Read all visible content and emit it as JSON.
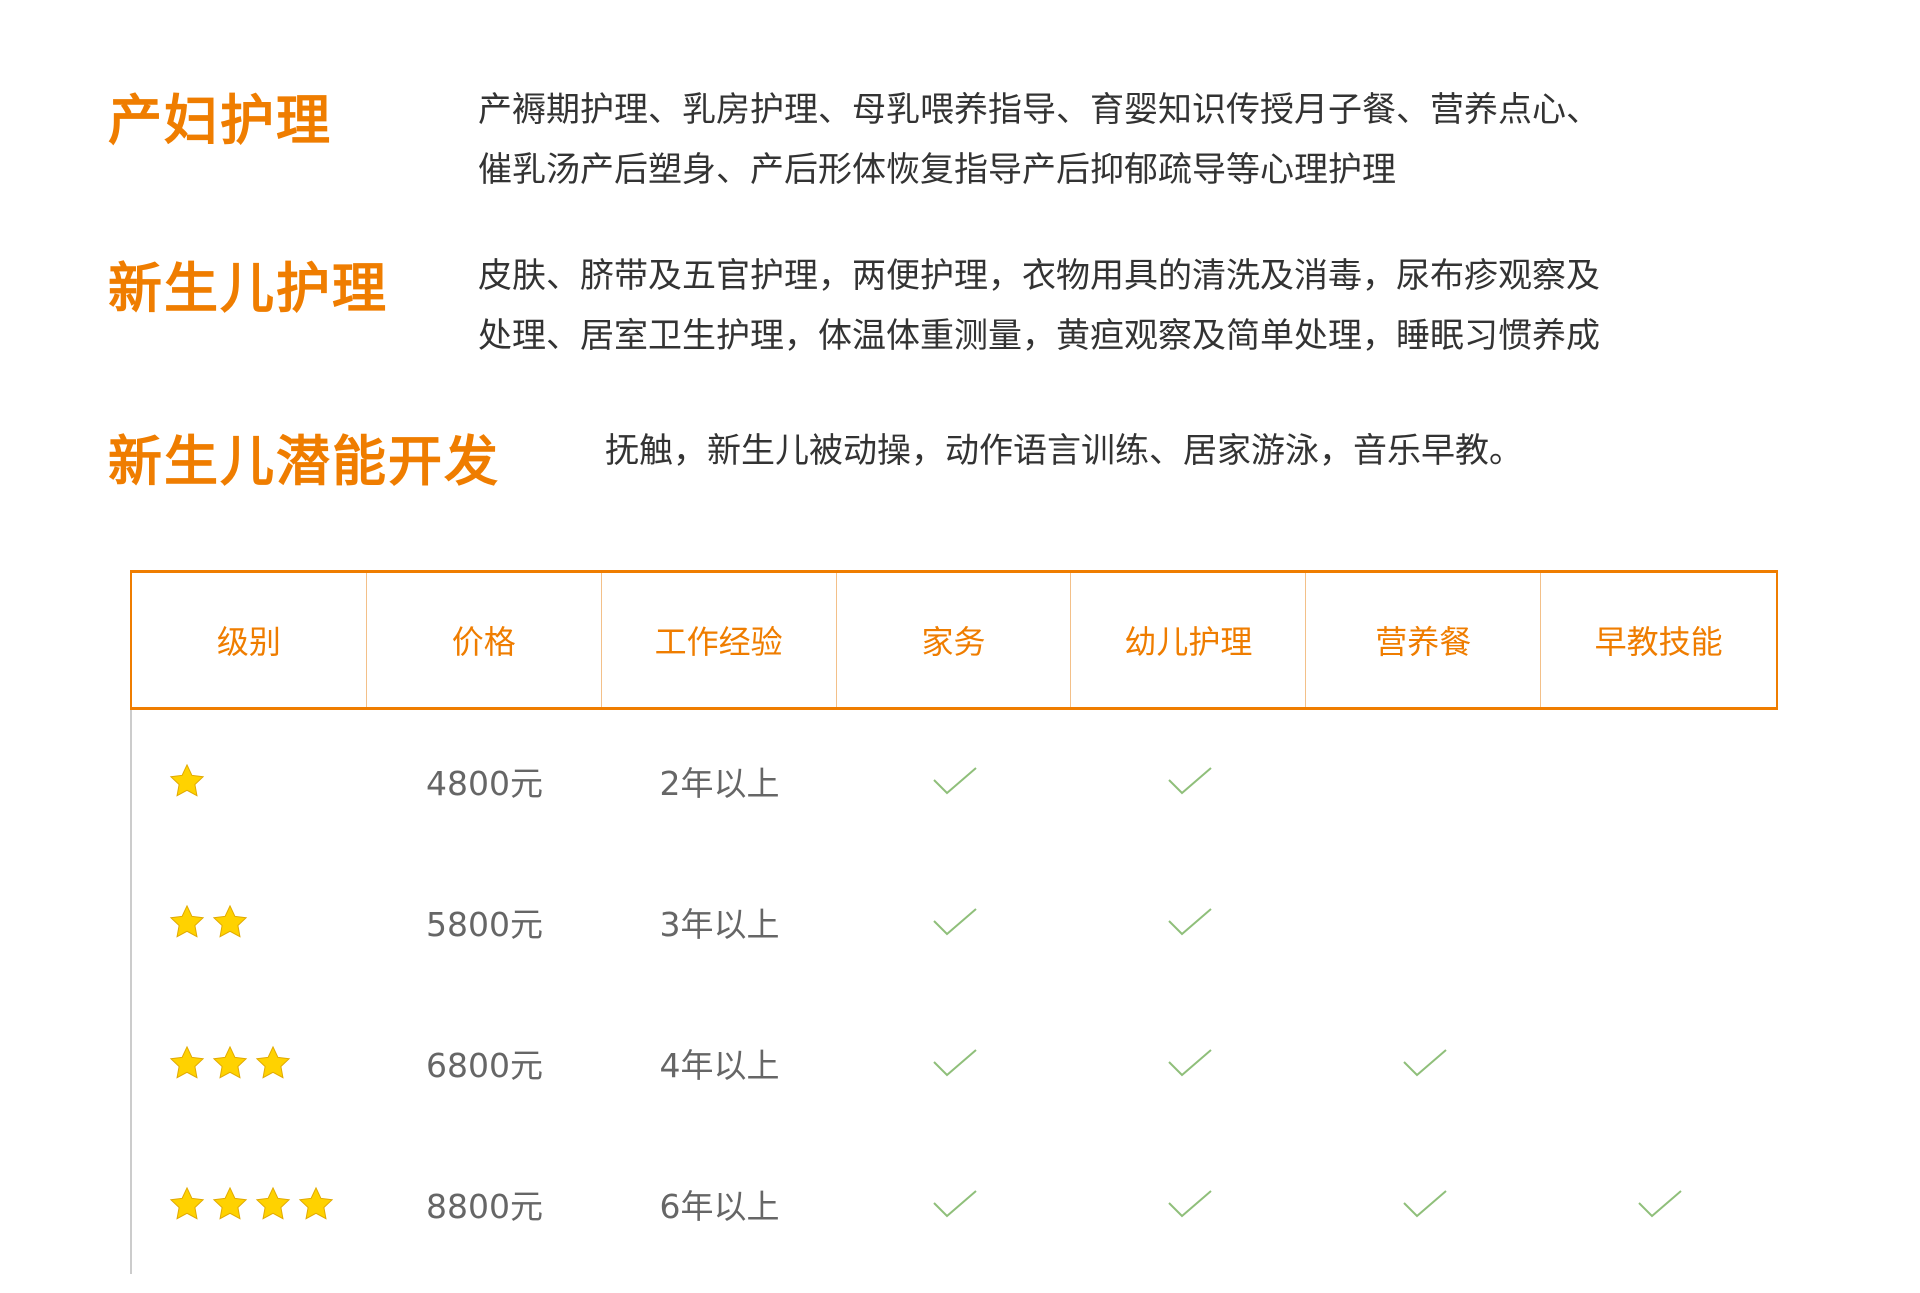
{
  "sections": [
    {
      "title": "产妇护理",
      "desc_lines": [
        "产褥期护理、乳房护理、母乳喂养指导、育婴知识传授月子餐、营养点心、",
        "催乳汤产后塑身、产后形体恢复指导产后抑郁疏导等心理护理"
      ]
    },
    {
      "title": "新生儿护理",
      "desc_lines": [
        "皮肤、脐带及五官护理，两便护理，衣物用具的清洗及消毒，尿布疹观察及",
        "处理、居室卫生护理，体温体重测量，黄疸观察及简单处理，睡眠习惯养成"
      ]
    },
    {
      "title": "新生儿潜能开发",
      "desc_lines": [
        "抚触，新生儿被动操，动作语言训练、居家游泳，音乐早教。"
      ]
    }
  ],
  "table": {
    "headers": [
      "级别",
      "价格",
      "工作经验",
      "家务",
      "幼儿护理",
      "营养餐",
      "早教技能"
    ],
    "rows": [
      {
        "stars": 1,
        "price": "4800元",
        "experience": "2年以上",
        "checks": [
          true,
          true,
          false,
          false
        ]
      },
      {
        "stars": 2,
        "price": "5800元",
        "experience": "3年以上",
        "checks": [
          true,
          true,
          false,
          false
        ]
      },
      {
        "stars": 3,
        "price": "6800元",
        "experience": "4年以上",
        "checks": [
          true,
          true,
          true,
          false
        ]
      },
      {
        "stars": 4,
        "price": "8800元",
        "experience": "6年以上",
        "checks": [
          true,
          true,
          true,
          true
        ]
      }
    ],
    "colors": {
      "accent": "#ef7d00",
      "star": "#ffd200",
      "check": "#8fbf7a"
    },
    "icons": {
      "star": "star-icon",
      "check": "checkmark-icon"
    }
  }
}
